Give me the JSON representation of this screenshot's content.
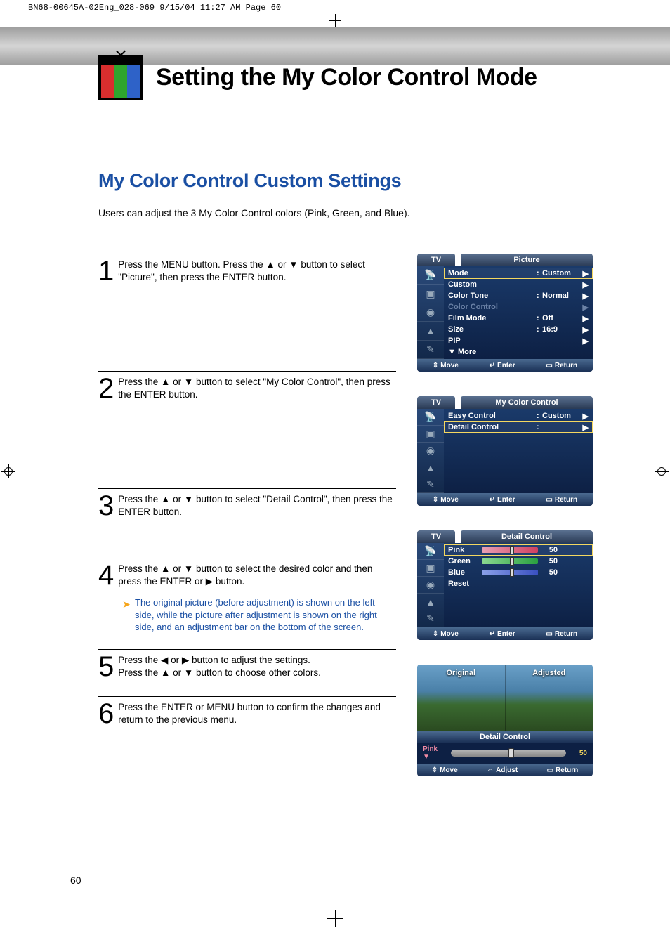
{
  "header_strip": "BN68-00645A-02Eng_028-069  9/15/04  11:27 AM  Page 60",
  "page_title": "Setting the My Color Control Mode",
  "section_heading": "My Color Control Custom Settings",
  "intro": "Users can adjust the 3 My Color Control colors (Pink, Green, and Blue).",
  "steps": {
    "s1": "Press the MENU button. Press the ▲ or ▼ button to select \"Picture\", then press the ENTER button.",
    "s2": "Press the ▲ or ▼ button to select \"My Color Control\", then press the ENTER button.",
    "s3": "Press the ▲ or ▼ button to select \"Detail Control\", then press the ENTER button.",
    "s4": "Press the ▲ or ▼ button to select the desired color and then press the ENTER or ▶ button.",
    "s4_note": "The original picture (before adjustment) is shown on the left side, while the picture after adjustment is shown on the right side, and an adjustment bar on the bottom of the screen.",
    "s5": "Press the ◀ or ▶ button to adjust the settings.\nPress the ▲ or ▼ button to choose other colors.",
    "s6": "Press the ENTER or MENU button to confirm the changes and return to the previous menu."
  },
  "osd_tv_label": "TV",
  "osd1": {
    "title": "Picture",
    "rows": [
      {
        "lab": "Mode",
        "val": "Custom",
        "sel": true
      },
      {
        "lab": "Custom",
        "val": ""
      },
      {
        "lab": "Color Tone",
        "val": "Normal"
      },
      {
        "lab": "Color Control",
        "val": "",
        "dim": true
      },
      {
        "lab": "Film Mode",
        "val": "Off"
      },
      {
        "lab": "Size",
        "val": "16:9"
      },
      {
        "lab": "PIP",
        "val": ""
      },
      {
        "lab": "▼ More",
        "val": "",
        "noarr": true
      }
    ],
    "foot": {
      "a": "Move",
      "b": "Enter",
      "c": "Return"
    }
  },
  "osd2": {
    "title": "My Color Control",
    "rows": [
      {
        "lab": "Easy Control",
        "val": "Custom"
      },
      {
        "lab": "Detail Control",
        "val": "",
        "sel": true
      }
    ],
    "foot": {
      "a": "Move",
      "b": "Enter",
      "c": "Return"
    }
  },
  "osd3": {
    "title": "Detail Control",
    "rows": [
      {
        "lab": "Pink",
        "val": "50",
        "slider": "pink",
        "sel": true
      },
      {
        "lab": "Green",
        "val": "50",
        "slider": "green"
      },
      {
        "lab": "Blue",
        "val": "50",
        "slider": "blue"
      },
      {
        "lab": "Reset",
        "val": ""
      }
    ],
    "foot": {
      "a": "Move",
      "b": "Enter",
      "c": "Return"
    }
  },
  "preview": {
    "left_label": "Original",
    "right_label": "Adjusted",
    "bar_title": "Detail Control",
    "param": "Pink",
    "value": "50",
    "foot": {
      "a": "Move",
      "b": "Adjust",
      "c": "Return"
    }
  },
  "page_number": "60"
}
